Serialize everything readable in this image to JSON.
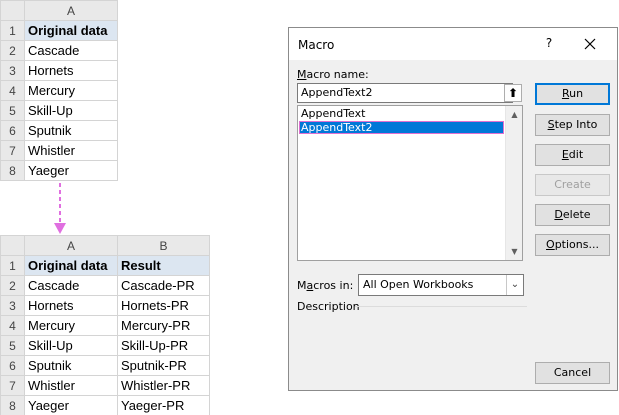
{
  "sheet1": {
    "col_header": "A",
    "rows": [
      {
        "num": "1",
        "a": "Original data"
      },
      {
        "num": "2",
        "a": "Cascade"
      },
      {
        "num": "3",
        "a": "Hornets"
      },
      {
        "num": "4",
        "a": "Mercury"
      },
      {
        "num": "5",
        "a": "Skill-Up"
      },
      {
        "num": "6",
        "a": "Sputnik"
      },
      {
        "num": "7",
        "a": "Whistler"
      },
      {
        "num": "8",
        "a": "Yaeger"
      }
    ]
  },
  "sheet2": {
    "col_headers": [
      "A",
      "B"
    ],
    "rows": [
      {
        "num": "1",
        "a": "Original data",
        "b": "Result"
      },
      {
        "num": "2",
        "a": "Cascade",
        "b": "Cascade-PR"
      },
      {
        "num": "3",
        "a": "Hornets",
        "b": "Hornets-PR"
      },
      {
        "num": "4",
        "a": "Mercury",
        "b": "Mercury-PR"
      },
      {
        "num": "5",
        "a": "Skill-Up",
        "b": "Skill-Up-PR"
      },
      {
        "num": "6",
        "a": "Sputnik",
        "b": "Sputnik-PR"
      },
      {
        "num": "7",
        "a": "Whistler",
        "b": "Whistler-PR"
      },
      {
        "num": "8",
        "a": "Yaeger",
        "b": "Yaeger-PR"
      }
    ]
  },
  "arrow": {
    "icon": "dashed-down-arrow-icon",
    "color": "#e06fe0"
  },
  "dialog": {
    "title": "Macro",
    "help": "?",
    "close_icon": "close-icon",
    "macro_name_label_u": "M",
    "macro_name_label_rest": "acro name:",
    "macro_name_value": "AppendText2",
    "upload_icon": "⬆",
    "list_items": [
      "AppendText",
      "AppendText2"
    ],
    "selected_index": 1,
    "macros_in_label_pre": "M",
    "macros_in_label_u": "a",
    "macros_in_label_rest": "cros in:",
    "macros_in_value": "All Open Workbooks",
    "description_label": "Description",
    "buttons": {
      "run_u": "R",
      "run_rest": "un",
      "step_into_u": "S",
      "step_into_rest": "tep Into",
      "edit_u": "E",
      "edit_rest": "dit",
      "create": "Create",
      "delete_u": "D",
      "delete_rest": "elete",
      "options_u": "O",
      "options_rest": "ptions...",
      "cancel": "Cancel"
    },
    "colors": {
      "selection": "#0078d7",
      "default_border": "#0078d7",
      "selection_outline": "#e070d0"
    }
  }
}
